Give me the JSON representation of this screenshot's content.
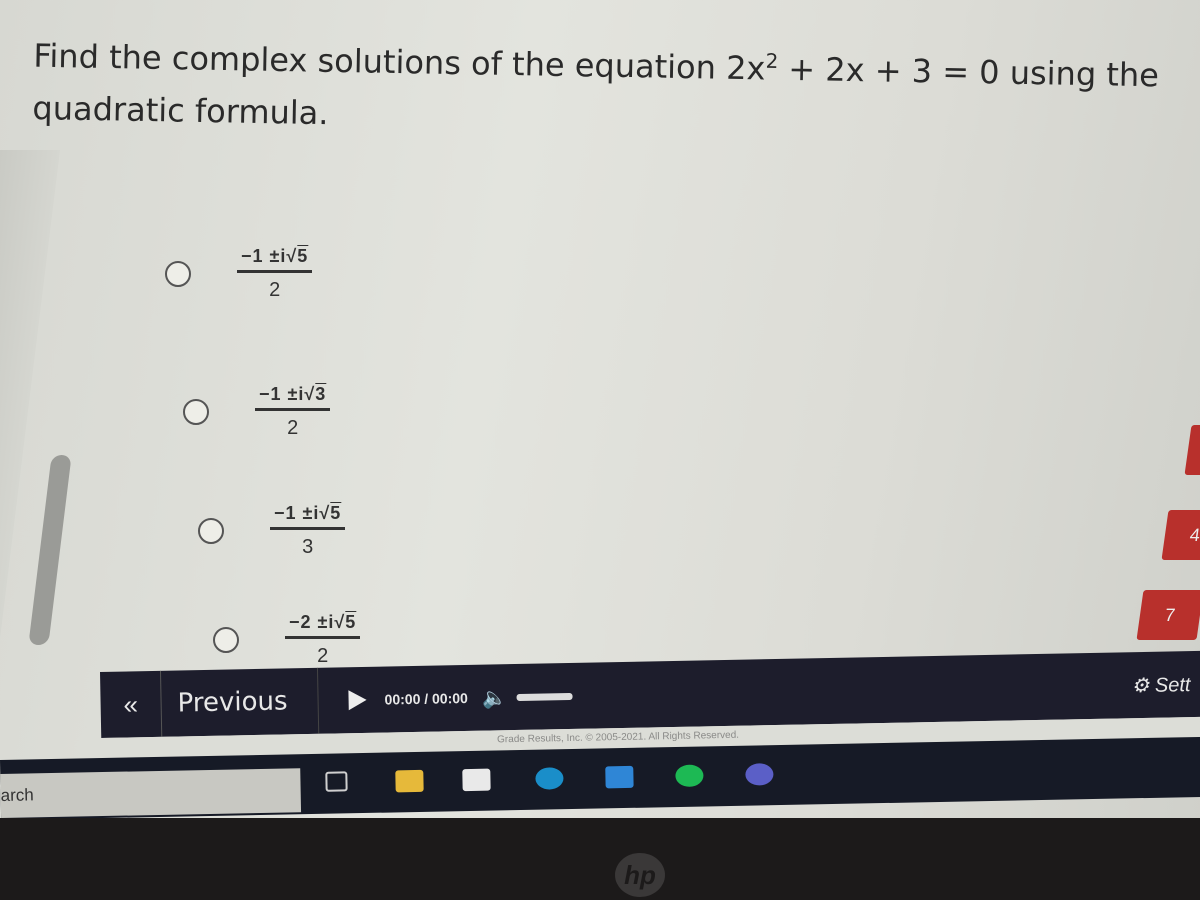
{
  "question": {
    "text_before": "Find the complex solutions of the equation 2x",
    "exponent": "2",
    "text_after": " + 2x + 3 = 0 using the",
    "line2": "quadratic formula."
  },
  "options": [
    {
      "prefix": "−1 ±i√",
      "radicand": "5",
      "denominator": "2",
      "selected": false
    },
    {
      "prefix": "−1 ±i√",
      "radicand": "3",
      "denominator": "2",
      "selected": false
    },
    {
      "prefix": "−1 ±i√",
      "radicand": "5",
      "denominator": "3",
      "selected": false
    },
    {
      "prefix": "−2 ±i√",
      "radicand": "5",
      "denominator": "2",
      "selected": false
    }
  ],
  "navbar": {
    "first_icon": "«",
    "previous_label": "Previous",
    "time_current": "00:00",
    "time_separator": " / ",
    "time_total": "00:00",
    "volume_icon": "🔈",
    "settings_label": "⚙ Sett"
  },
  "footer": {
    "copyright": "Grade Results, Inc. © 2005-2021. All Rights Reserved."
  },
  "side_tiles": [
    "",
    "4",
    "7",
    ""
  ],
  "taskbar": {
    "search_text": "arch",
    "icons": [
      {
        "name": "task-view-icon",
        "color": "#cfcfcf"
      },
      {
        "name": "file-explorer-icon",
        "color": "#e6b93a"
      },
      {
        "name": "store-icon",
        "color": "#e9e9e9"
      },
      {
        "name": "edge-icon",
        "color": "#1a8ec9"
      },
      {
        "name": "mail-icon",
        "color": "#2f86d6"
      },
      {
        "name": "spotify-icon",
        "color": "#1db954"
      },
      {
        "name": "teams-icon",
        "color": "#5b5fc7"
      }
    ]
  },
  "brand": {
    "logo": "hp"
  },
  "colors": {
    "navbar": "#1d1d2c",
    "tile_red": "#b8302c",
    "taskbar": "#161a26"
  }
}
